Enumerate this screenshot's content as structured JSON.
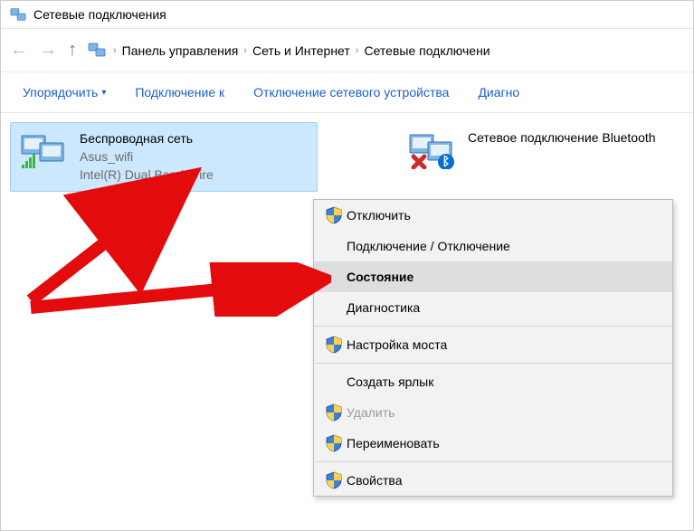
{
  "window": {
    "title": "Сетевые подключения"
  },
  "breadcrumbs": {
    "items": [
      "Панель управления",
      "Сеть и Интернет",
      "Сетевые подключени"
    ]
  },
  "toolbar": {
    "organize": "Упорядочить",
    "connect": "Подключение к",
    "disable": "Отключение сетевого устройства",
    "diag": "Диагно"
  },
  "connections": {
    "wifi": {
      "name": "Беспроводная сеть",
      "ssid": "Asus_wifi",
      "adapter": "Intel(R) Dual Band Wire"
    },
    "bt": {
      "name": "Сетевое подключение Bluetooth"
    }
  },
  "context_menu": {
    "disable": "Отключить",
    "conn_disconn": "Подключение / Отключение",
    "status": "Состояние",
    "diagnostics": "Диагностика",
    "bridge": "Настройка моста",
    "shortcut": "Создать ярлык",
    "delete": "Удалить",
    "rename": "Переименовать",
    "properties": "Свойства"
  }
}
